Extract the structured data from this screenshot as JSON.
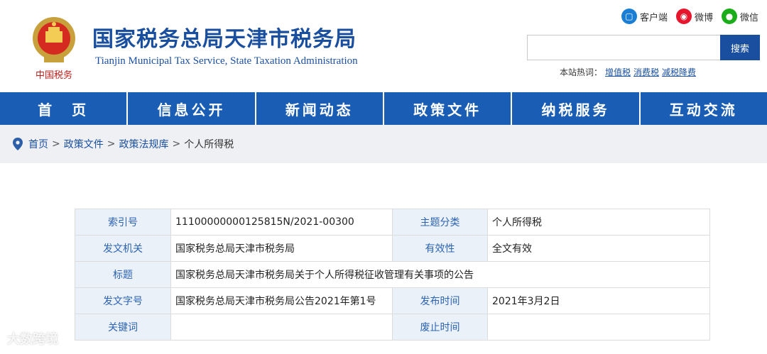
{
  "header": {
    "title": "国家税务总局天津市税务局",
    "subtitle": "Tianjin Municipal Tax Service, State Taxation Administration",
    "logo_caption": "中国税务",
    "top_links": [
      {
        "label": "客户端",
        "icon": "client-icon",
        "color": "#1a7fd4"
      },
      {
        "label": "微博",
        "icon": "weibo-icon",
        "color": "#e6162d"
      },
      {
        "label": "微信",
        "icon": "wechat-icon",
        "color": "#1aad19"
      }
    ],
    "search": {
      "placeholder": "",
      "button_label": "搜索"
    },
    "hotwords": {
      "label": "本站热词：",
      "items": [
        "增值税",
        "消费税",
        "减税降费"
      ]
    }
  },
  "nav": {
    "items": [
      "首　页",
      "信息公开",
      "新闻动态",
      "政策文件",
      "纳税服务",
      "互动交流"
    ]
  },
  "breadcrumb": {
    "items": [
      "首页",
      "政策文件",
      "政策法规库"
    ],
    "current": "个人所得税",
    "separator": ">"
  },
  "document_info": {
    "index_label": "索引号",
    "index_value": "11100000000125815N/2021-00300",
    "category_label": "主题分类",
    "category_value": "个人所得税",
    "issuer_label": "发文机关",
    "issuer_value": "国家税务总局天津市税务局",
    "validity_label": "有效性",
    "validity_value": "全文有效",
    "title_label": "标题",
    "title_value": "国家税务总局天津市税务局关于个人所得税征收管理有关事项的公告",
    "docno_label": "发文字号",
    "docno_value": "国家税务总局天津市税务局公告2021年第1号",
    "pubdate_label": "发布时间",
    "pubdate_value": "2021年3月2日",
    "keywords_label": "关键词",
    "keywords_value": "",
    "expiry_label": "废止时间",
    "expiry_value": ""
  },
  "watermark": "大数跨境",
  "colors": {
    "brand_blue": "#1a4fa0",
    "nav_blue": "#1a5db4",
    "label_bg": "#eaf1f9",
    "crumb_bg": "#eef0f3"
  }
}
